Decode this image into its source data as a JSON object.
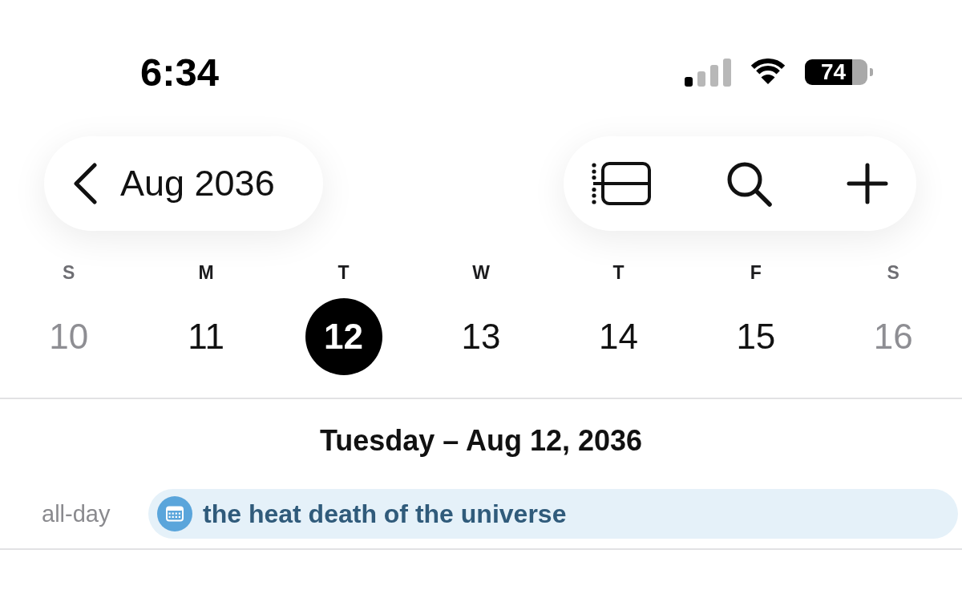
{
  "status_bar": {
    "time": "6:34",
    "battery": "74"
  },
  "header": {
    "month": "Aug 2036"
  },
  "week": {
    "days": [
      {
        "weekday": "S",
        "date": "10",
        "weekend": true,
        "selected": false
      },
      {
        "weekday": "M",
        "date": "11",
        "weekend": false,
        "selected": false
      },
      {
        "weekday": "T",
        "date": "12",
        "weekend": false,
        "selected": true
      },
      {
        "weekday": "W",
        "date": "13",
        "weekend": false,
        "selected": false
      },
      {
        "weekday": "T",
        "date": "14",
        "weekend": false,
        "selected": false
      },
      {
        "weekday": "F",
        "date": "15",
        "weekend": false,
        "selected": false
      },
      {
        "weekday": "S",
        "date": "16",
        "weekend": true,
        "selected": false
      }
    ]
  },
  "day": {
    "title": "Tuesday – Aug 12, 2036",
    "all_day_label": "all-day",
    "all_day_events": [
      {
        "title": "the heat death of the universe",
        "color": "#5aa5db"
      }
    ]
  }
}
